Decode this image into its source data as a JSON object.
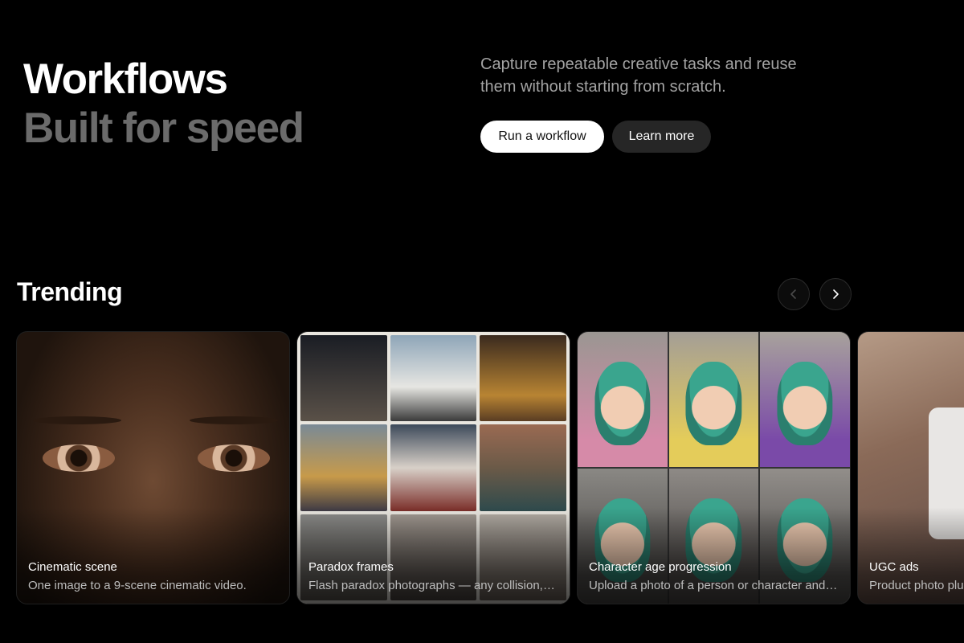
{
  "hero": {
    "title_line1": "Workflows",
    "title_line2": "Built for speed",
    "description": "Capture repeatable creative tasks and reuse them without starting from scratch.",
    "primary_button": "Run a workflow",
    "secondary_button": "Learn more"
  },
  "trending": {
    "heading": "Trending",
    "prev_icon": "chevron-left-icon",
    "next_icon": "chevron-right-icon",
    "cards": [
      {
        "title": "Cinematic scene",
        "subtitle": "One image to a 9-scene cinematic video."
      },
      {
        "title": "Paradox frames",
        "subtitle": "Flash paradox photographs — any collision, any era, any place."
      },
      {
        "title": "Character age progression",
        "subtitle": "Upload a photo of a person or character and see them at every age."
      },
      {
        "title": "UGC ads",
        "subtitle": "Product photo plus avatar into a UGC ad."
      }
    ]
  },
  "colors": {
    "background": "#000000",
    "title_secondary": "#6b6b6b",
    "primary_button_bg": "#ffffff",
    "secondary_button_bg": "#262626"
  }
}
